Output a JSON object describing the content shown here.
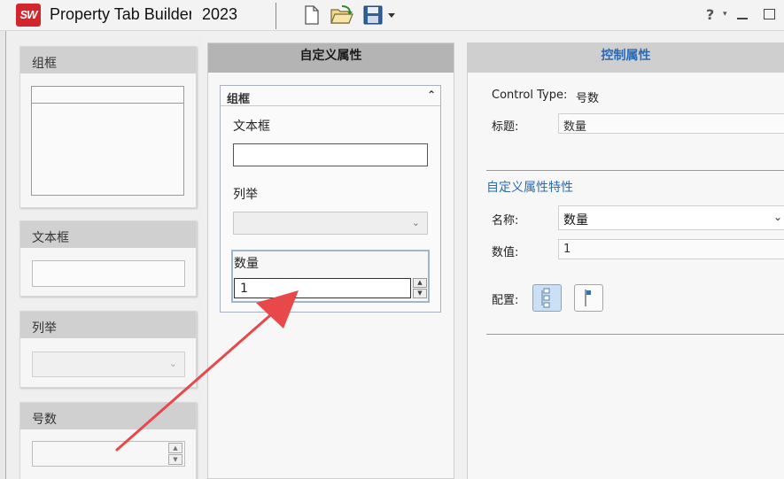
{
  "window": {
    "app_title": "Property Tab Builder",
    "year": "2023"
  },
  "toolbar": {
    "icons": [
      "new-document-icon",
      "open-folder-icon",
      "save-disk-icon",
      "dropdown-caret-icon"
    ],
    "help_label": "?",
    "help_caret": "▾"
  },
  "palette": {
    "groupbox_label": "组框",
    "textbox_label": "文本框",
    "list_label": "列举",
    "number_label": "号数"
  },
  "custom_properties": {
    "header": "自定义属性",
    "group_label": "组框",
    "textbox_label": "文本框",
    "textbox_value": "",
    "list_label": "列举",
    "list_value": "",
    "number_label": "数量",
    "number_value": "1"
  },
  "control_properties": {
    "header": "控制属性",
    "control_type_label": "Control Type:",
    "control_type_value": "号数",
    "caption_label": "标题:",
    "caption_value": "数量",
    "section_title": "自定义属性特性",
    "name_label": "名称:",
    "name_value": "数量",
    "value_label": "数值:",
    "value_value": "1",
    "config_label": "配置:"
  },
  "colors": {
    "accent_blue": "#2b6cb3",
    "arrow_red": "#e8484a",
    "sw_red": "#d2262c"
  }
}
